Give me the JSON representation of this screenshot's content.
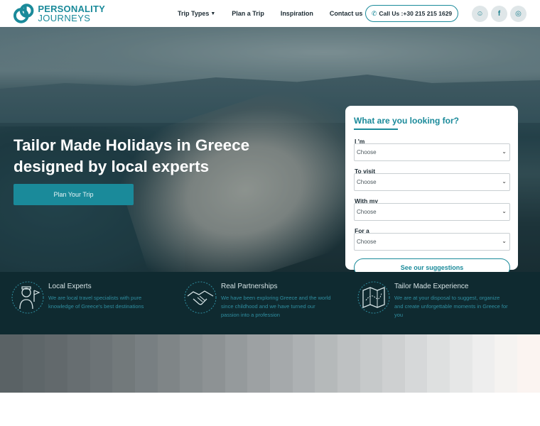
{
  "brand": {
    "name_line1": "PERSONALITY",
    "name_line2": "JOURNEYS",
    "accent_color": "#1a8a9a"
  },
  "nav": {
    "items": [
      {
        "label": "Trip Types",
        "has_caret": true
      },
      {
        "label": "Plan a Trip"
      },
      {
        "label": "Inspiration"
      },
      {
        "label": "Contact us"
      }
    ],
    "call_label": "Call Us :+30 215 215 1629",
    "social": [
      {
        "icon": "chat-icon",
        "glyph": "☺"
      },
      {
        "icon": "facebook-icon",
        "glyph": "f"
      },
      {
        "icon": "instagram-icon",
        "glyph": "◎"
      }
    ]
  },
  "hero": {
    "title": "Tailor Made Holidays in Greece designed by local experts",
    "cta_label": "Plan Your Trip"
  },
  "search": {
    "title": "What are you looking for?",
    "fields": [
      {
        "label": "I 'm",
        "value": "Choose"
      },
      {
        "label": "To visit",
        "value": "Choose"
      },
      {
        "label": "With my",
        "value": "Choose"
      },
      {
        "label": "For a",
        "value": "Choose"
      }
    ],
    "submit_label": "See our suggestions"
  },
  "features": [
    {
      "icon": "guide-icon",
      "title": "Local Experts",
      "desc": "We are local travel specialists with pure knowledge of Greece's best destinations"
    },
    {
      "icon": "handshake-icon",
      "title": "Real Partnerships",
      "desc": "We have been exploring Greece and the world since childhood and we have turned our passion into a profession"
    },
    {
      "icon": "map-icon",
      "title": "Tailor Made Experience",
      "desc": "We are at your disposal to suggest, organize and create unforgettable moments in Greece for you"
    }
  ],
  "stripe_colors": [
    "#5a6265",
    "#5e6669",
    "#62696c",
    "#676e71",
    "#6c7376",
    "#72797b",
    "#787f82",
    "#7f8587",
    "#868c8e",
    "#8d9294",
    "#959a9c",
    "#9da1a3",
    "#a5a9ab",
    "#adb1b3",
    "#b5b9ba",
    "#bec1c2",
    "#c6c9ca",
    "#ced0d1",
    "#d6d8d9",
    "#dee0e0",
    "#e6e7e7",
    "#eeeeee",
    "#f5f3f1",
    "#fbf4f1"
  ]
}
